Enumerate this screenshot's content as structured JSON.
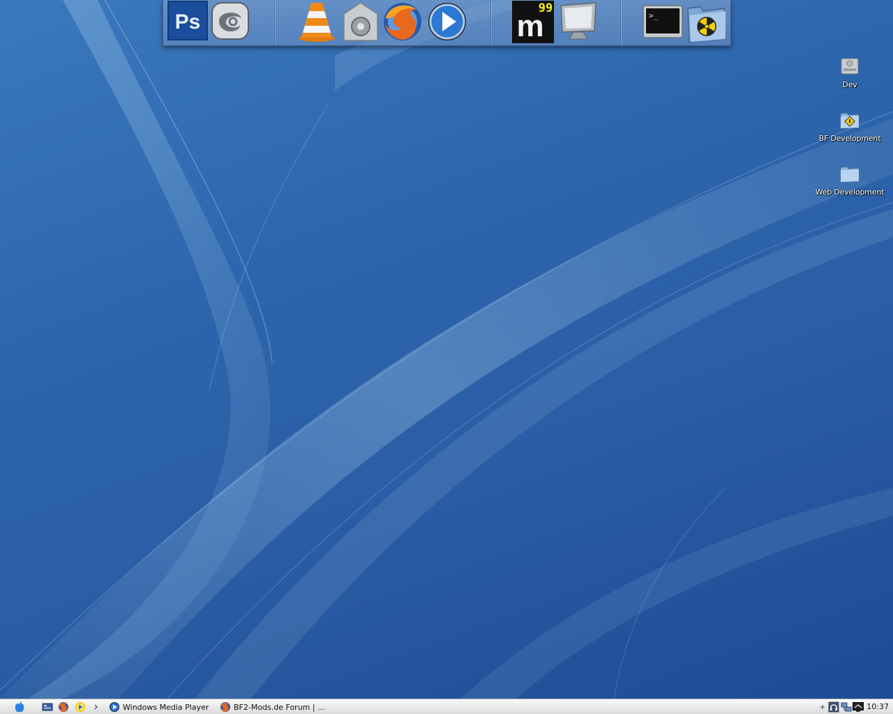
{
  "dock": {
    "items": [
      {
        "icon": "photoshop-icon"
      },
      {
        "icon": "3ds-max-icon"
      },
      {
        "icon": "vlc-icon"
      },
      {
        "icon": "firewall-safe-icon"
      },
      {
        "icon": "firefox-icon"
      },
      {
        "icon": "media-player-icon"
      },
      {
        "icon": "meedio-icon",
        "badge": "99"
      },
      {
        "icon": "monitor-icon"
      },
      {
        "icon": "terminal-icon",
        "prompt": ">_"
      },
      {
        "icon": "burn-folder-icon"
      }
    ]
  },
  "desktop": {
    "icons": [
      {
        "label": "Dev",
        "icon": "hard-drive-icon"
      },
      {
        "label": "BF Development",
        "icon": "folder-warning-icon"
      },
      {
        "label": "Web Development",
        "icon": "folder-icon"
      }
    ]
  },
  "taskbar": {
    "start_icon": "apple-start-icon",
    "quick_launch": [
      "show-desktop-icon",
      "firefox-icon",
      "media-player-icon",
      "chevron-right-icon"
    ],
    "windows": [
      {
        "label": "Windows Media Player",
        "icon": "media-player-icon"
      },
      {
        "label": "BF2-Mods.de Forum | ...",
        "icon": "firefox-icon"
      }
    ],
    "tray_icons": [
      "plus-icon",
      "headset-icon",
      "network-icon",
      "monitor-tray-icon"
    ],
    "clock": "10:37"
  },
  "colors": {
    "wallpaper": "#2f64a8",
    "taskbar": "#ececec",
    "dock": "#8aa8d2"
  }
}
